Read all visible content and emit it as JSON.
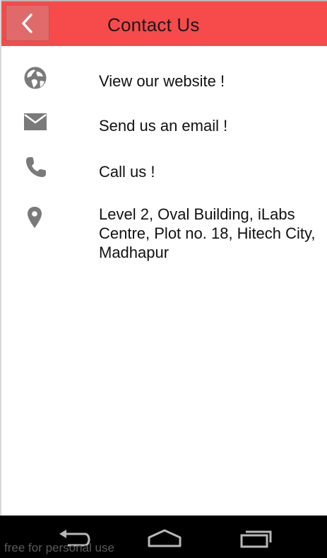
{
  "header": {
    "title": "Contact Us",
    "back_icon": "chevron-left-icon",
    "bg_color": "#f74a4a"
  },
  "contact_items": [
    {
      "icon": "globe-icon",
      "label": "View our website !"
    },
    {
      "icon": "mail-icon",
      "label": "Send us an email !"
    },
    {
      "icon": "phone-icon",
      "label": "Call us !"
    },
    {
      "icon": "location-pin-icon",
      "label": "Level 2, Oval Building, iLabs",
      "label_line2": "Centre, Plot no. 18, Hitech City,",
      "label_line3": "Madhapur"
    }
  ],
  "navbar": {
    "back": "back-icon",
    "home": "home-icon",
    "recents": "recent-apps-icon"
  },
  "watermark": "free for personal use"
}
